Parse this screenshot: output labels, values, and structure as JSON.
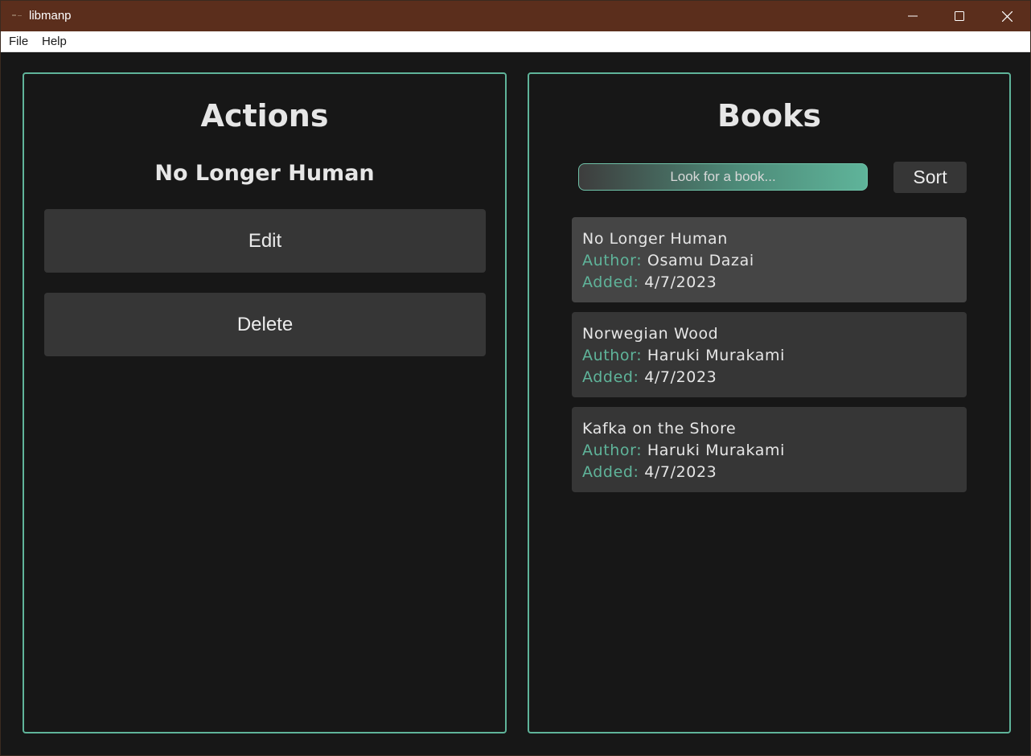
{
  "window": {
    "title": "libmanp"
  },
  "menu": {
    "items": [
      "File",
      "Help"
    ]
  },
  "actions_panel": {
    "title": "Actions",
    "selected_book": "No Longer Human",
    "edit_label": "Edit",
    "delete_label": "Delete"
  },
  "books_panel": {
    "title": "Books",
    "search_placeholder": "Look for a book...",
    "sort_label": "Sort",
    "author_label": "Author:",
    "added_label": "Added:",
    "books": [
      {
        "title": "No Longer Human",
        "author": "Osamu Dazai",
        "added": "4/7/2023",
        "selected": true
      },
      {
        "title": "Norwegian Wood",
        "author": "Haruki Murakami",
        "added": "4/7/2023",
        "selected": false
      },
      {
        "title": "Kafka on the Shore",
        "author": "Haruki Murakami",
        "added": "4/7/2023",
        "selected": false
      }
    ]
  },
  "colors": {
    "title_bar": "#5b2e1c",
    "accent": "#5fb49a",
    "background": "#171717",
    "button": "#363636",
    "selected_card": "#454545"
  }
}
